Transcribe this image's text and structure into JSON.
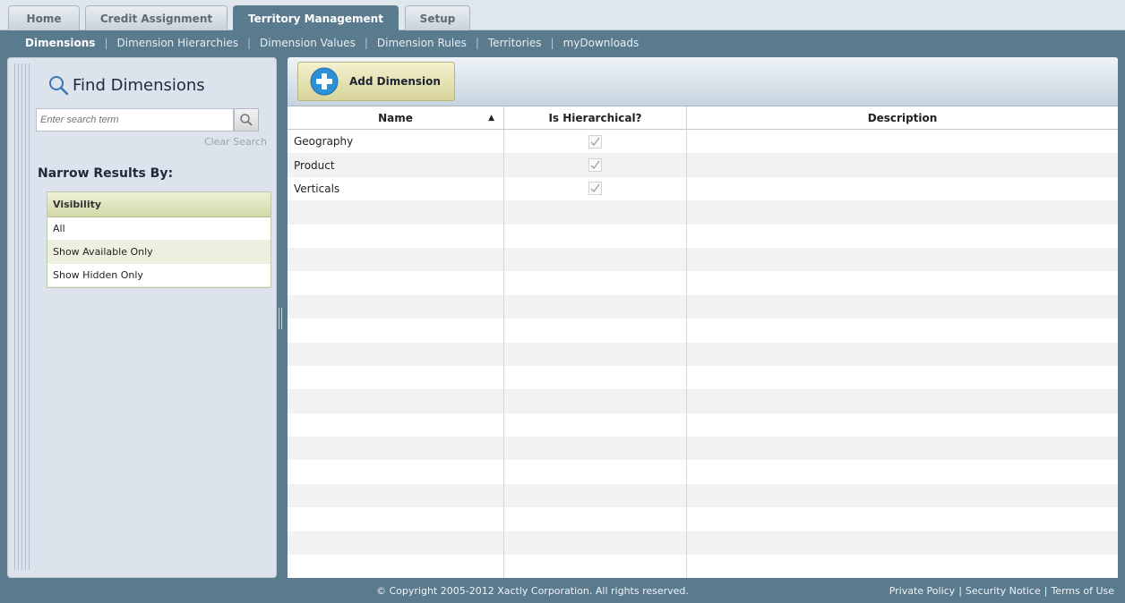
{
  "tabs": [
    {
      "label": "Home",
      "active": false
    },
    {
      "label": "Credit Assignment",
      "active": false
    },
    {
      "label": "Territory Management",
      "active": true
    },
    {
      "label": "Setup",
      "active": false
    }
  ],
  "subnav": [
    {
      "label": "Dimensions",
      "active": true
    },
    {
      "label": "Dimension Hierarchies",
      "active": false
    },
    {
      "label": "Dimension Values",
      "active": false
    },
    {
      "label": "Dimension Rules",
      "active": false
    },
    {
      "label": "Territories",
      "active": false
    },
    {
      "label": "myDownloads",
      "active": false
    }
  ],
  "left": {
    "find_title": "Find Dimensions",
    "search_placeholder": "Enter search term",
    "clear_search": "Clear Search",
    "narrow_title": "Narrow Results By:",
    "filter_header": "Visibility",
    "filter_items": [
      "All",
      "Show Available Only",
      "Show Hidden Only"
    ]
  },
  "toolbar": {
    "add_label": "Add Dimension"
  },
  "grid": {
    "columns": [
      "Name",
      "Is Hierarchical?",
      "Description"
    ],
    "sort_indicator": "▲",
    "rows": [
      {
        "name": "Geography",
        "hierarchical": true,
        "description": ""
      },
      {
        "name": "Product",
        "hierarchical": true,
        "description": ""
      },
      {
        "name": "Verticals",
        "hierarchical": true,
        "description": ""
      }
    ]
  },
  "footer": {
    "copyright": "© Copyright 2005-2012 Xactly Corporation. All rights reserved.",
    "links": [
      "Private Policy",
      "Security Notice",
      "Terms of Use"
    ]
  },
  "colors": {
    "frame": "#5a7a8e",
    "accent_button": "#d8d39a",
    "filter_header": "#d3d8a8"
  }
}
